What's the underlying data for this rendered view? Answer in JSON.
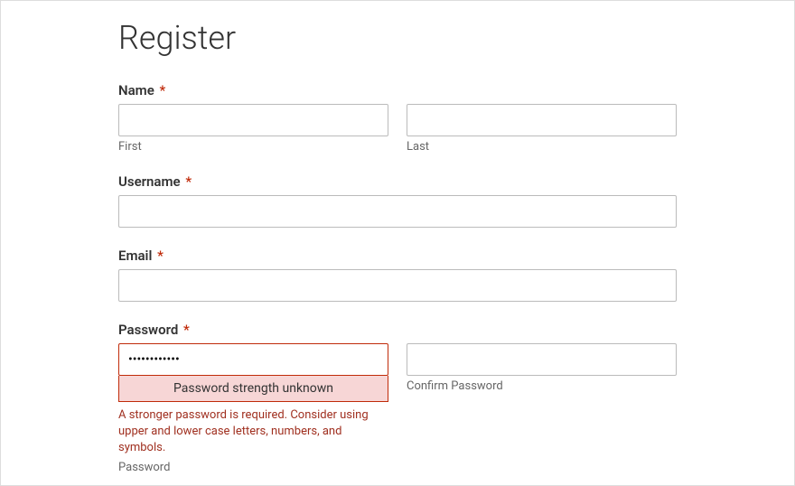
{
  "title": "Register",
  "required_marker": "*",
  "fields": {
    "name": {
      "label": "Name",
      "first_sublabel": "First",
      "last_sublabel": "Last",
      "first_value": "",
      "last_value": ""
    },
    "username": {
      "label": "Username",
      "value": ""
    },
    "email": {
      "label": "Email",
      "value": ""
    },
    "password": {
      "label": "Password",
      "value": "••••••••••••",
      "confirm_value": "",
      "confirm_sublabel": "Confirm Password",
      "password_sublabel": "Password",
      "strength_text": "Password strength unknown",
      "validation_message": "A stronger password is required. Consider using upper and lower case letters, numbers, and symbols."
    }
  }
}
